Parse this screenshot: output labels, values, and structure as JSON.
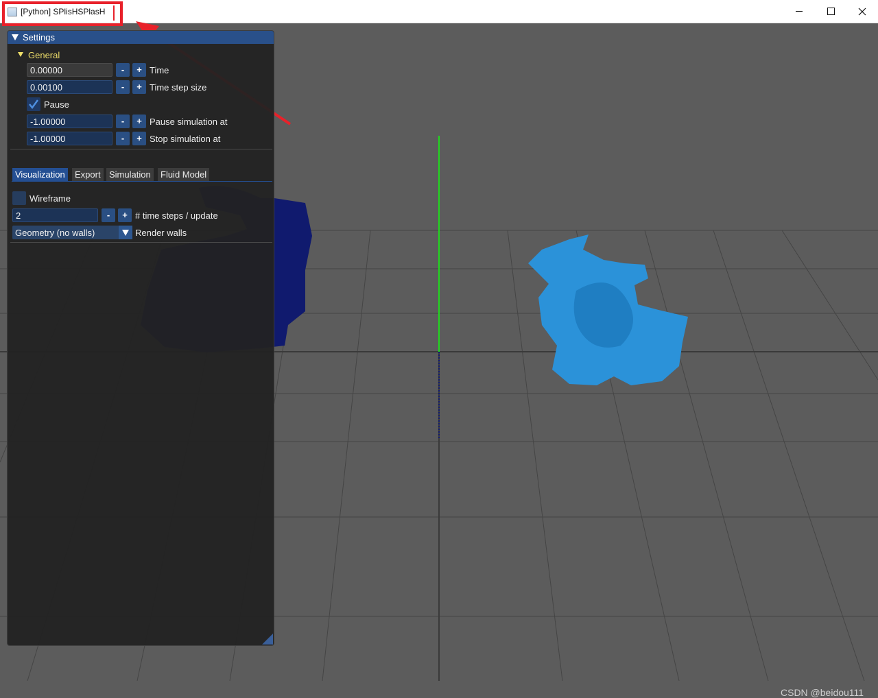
{
  "window": {
    "title": "[Python] SPlisHSPlasH",
    "minimize_label": "minimize",
    "maximize_label": "maximize",
    "close_label": "close"
  },
  "settings": {
    "header": "Settings",
    "general": {
      "title": "General",
      "time": {
        "value": "0.00000",
        "label": "Time"
      },
      "time_step_size": {
        "value": "0.00100",
        "label": "Time step size"
      },
      "pause": {
        "label": "Pause",
        "checked": true
      },
      "pause_simulation_at": {
        "value": "-1.00000",
        "label": "Pause simulation at"
      },
      "stop_simulation_at": {
        "value": "-1.00000",
        "label": "Stop simulation at"
      },
      "minus": "-",
      "plus": "+"
    },
    "tabs": [
      {
        "label": "Visualization",
        "active": true
      },
      {
        "label": "Export",
        "active": false
      },
      {
        "label": "Simulation",
        "active": false
      },
      {
        "label": "Fluid Model",
        "active": false
      }
    ],
    "visualization": {
      "wireframe": {
        "label": "Wireframe",
        "checked": false
      },
      "time_steps_per_update": {
        "value": "2",
        "label": "# time steps / update"
      },
      "render_walls": {
        "value": "Geometry (no walls)",
        "label": "Render walls"
      }
    }
  },
  "watermark": "CSDN @beidou111",
  "colors": {
    "accent_blue": "#29508a",
    "general_title": "#eede6a",
    "annotation_red": "#e8212a",
    "dragon": "#2b92d9",
    "particles": "#101a6e",
    "axis_green": "#21d61f"
  },
  "icons": {
    "collapse": "triangle-down-icon",
    "checkbox": "check-icon",
    "combo": "dropdown-arrow-icon"
  }
}
